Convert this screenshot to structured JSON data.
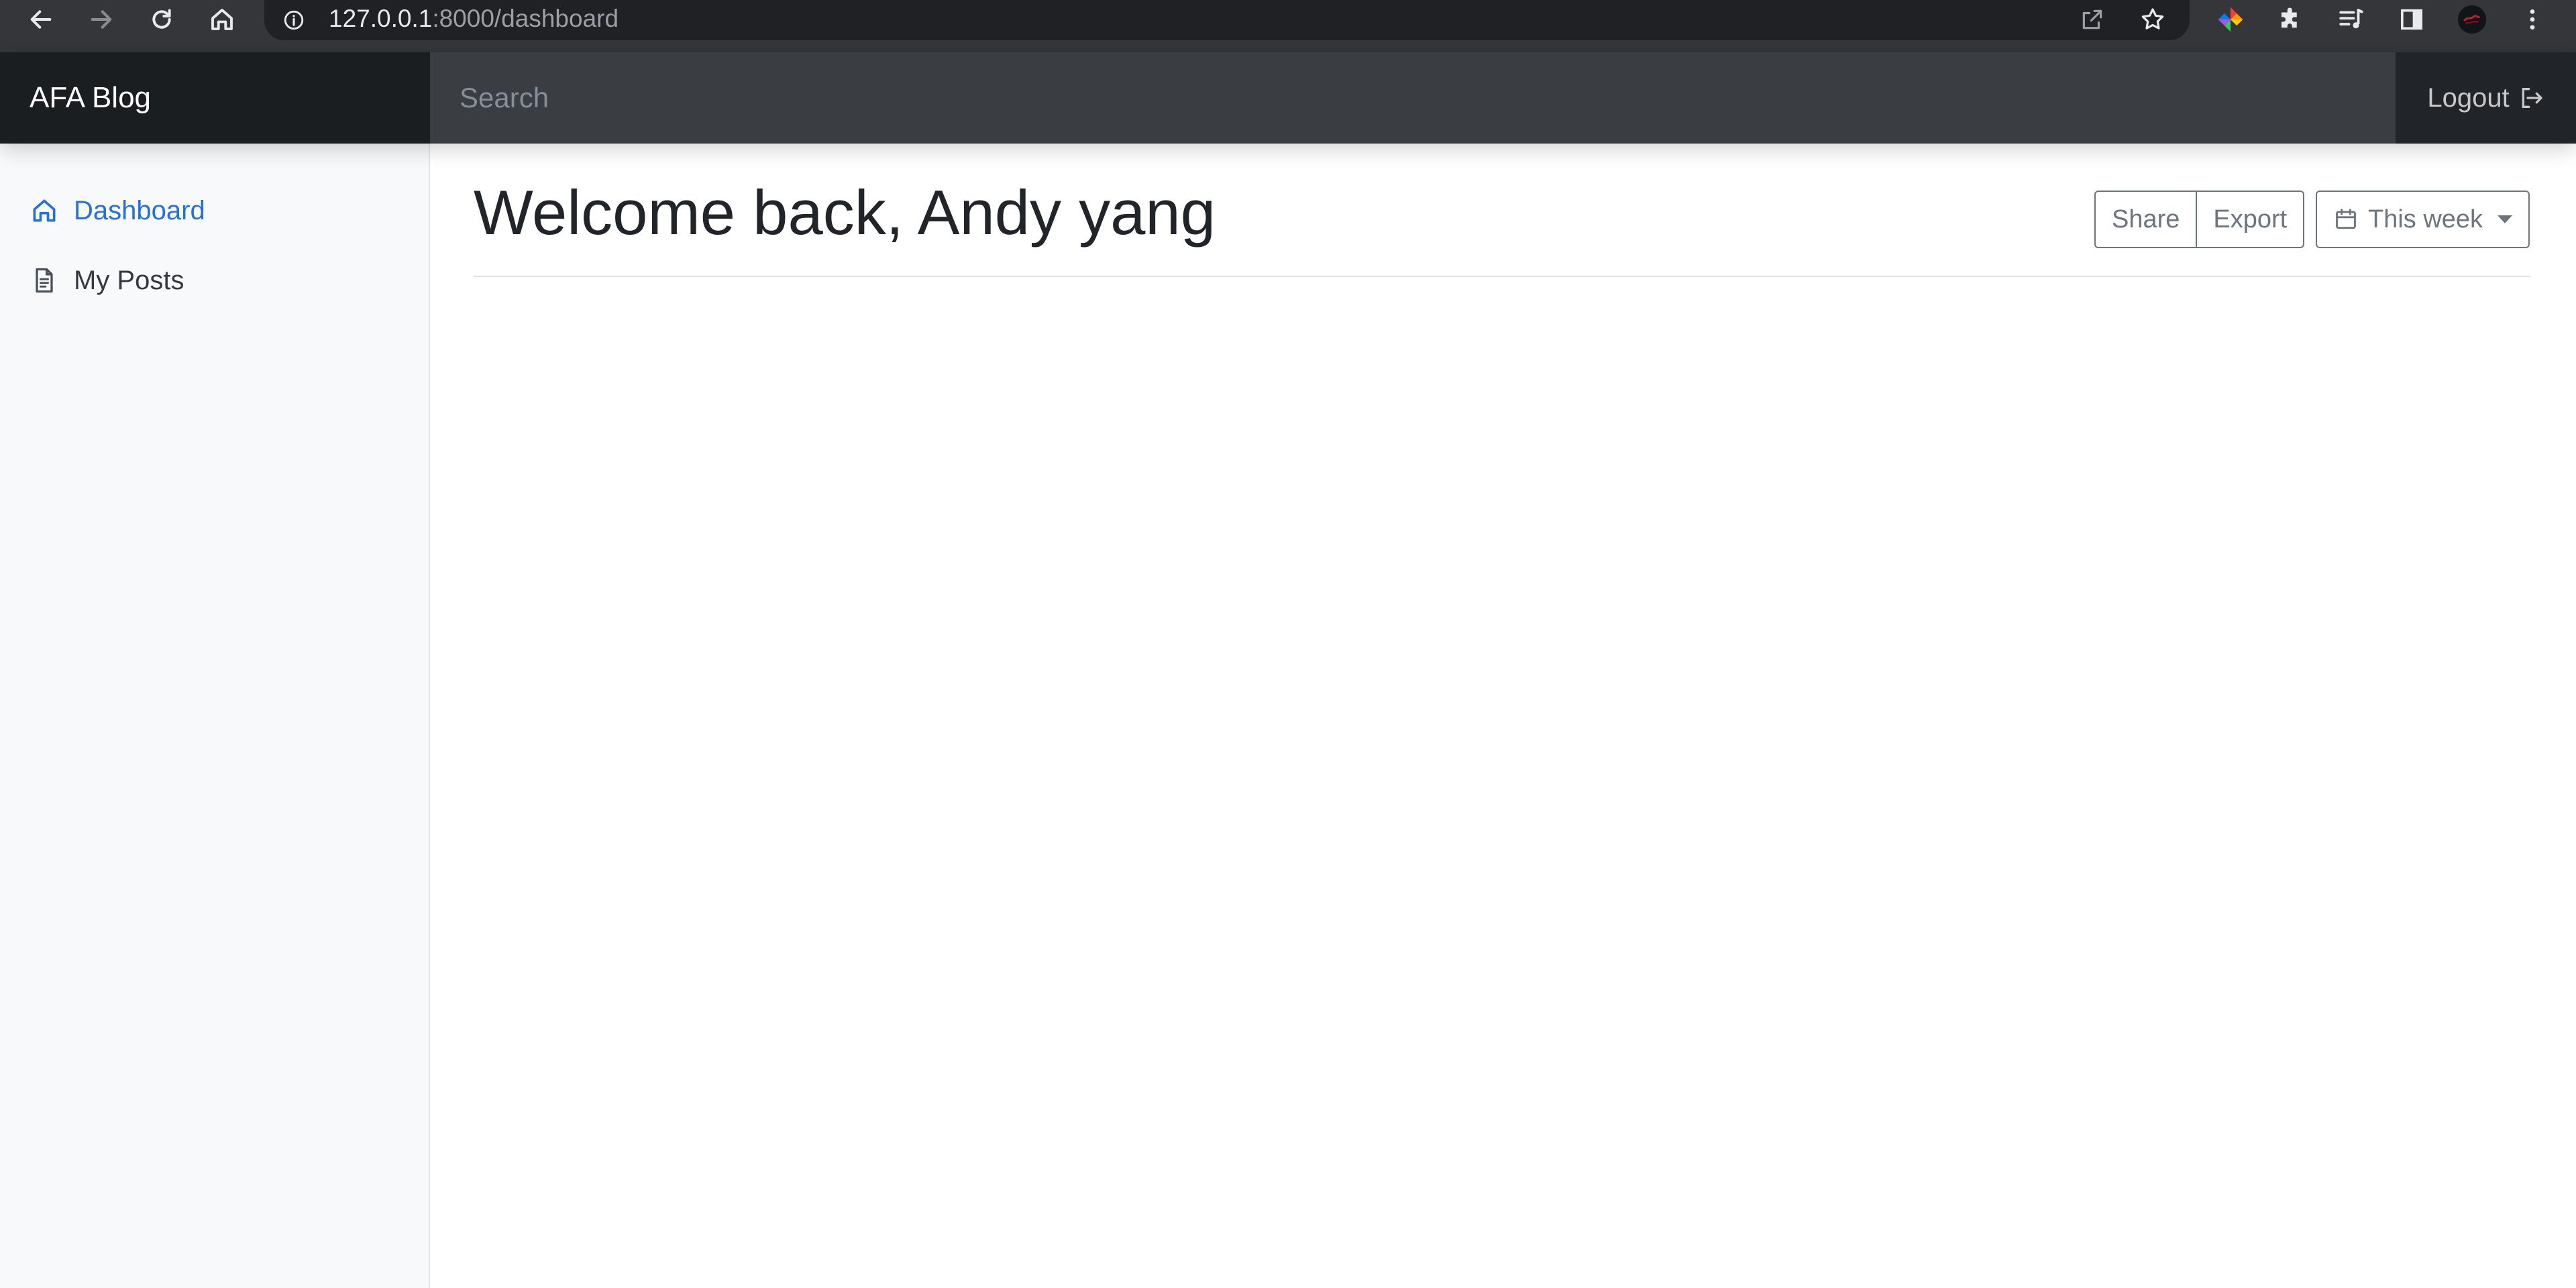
{
  "browser": {
    "url_host": "127.0.0.1",
    "url_path": ":8000/dashboard"
  },
  "navbar": {
    "brand": "AFA Blog",
    "search_placeholder": "Search",
    "logout_label": "Logout"
  },
  "sidebar": {
    "items": [
      {
        "label": "Dashboard",
        "icon": "home-icon",
        "active": true
      },
      {
        "label": "My Posts",
        "icon": "file-text-icon",
        "active": false
      }
    ]
  },
  "main": {
    "title": "Welcome back, Andy yang",
    "toolbar": {
      "share_label": "Share",
      "export_label": "Export",
      "range_label": "This week"
    }
  },
  "colors": {
    "navbar_bg": "#212529",
    "brand_bg": "#1b1e21",
    "search_bg": "#3a3d41",
    "sidebar_bg": "#f8f9fa",
    "active_link": "#2470dc",
    "outline_button": "#6c757d"
  }
}
